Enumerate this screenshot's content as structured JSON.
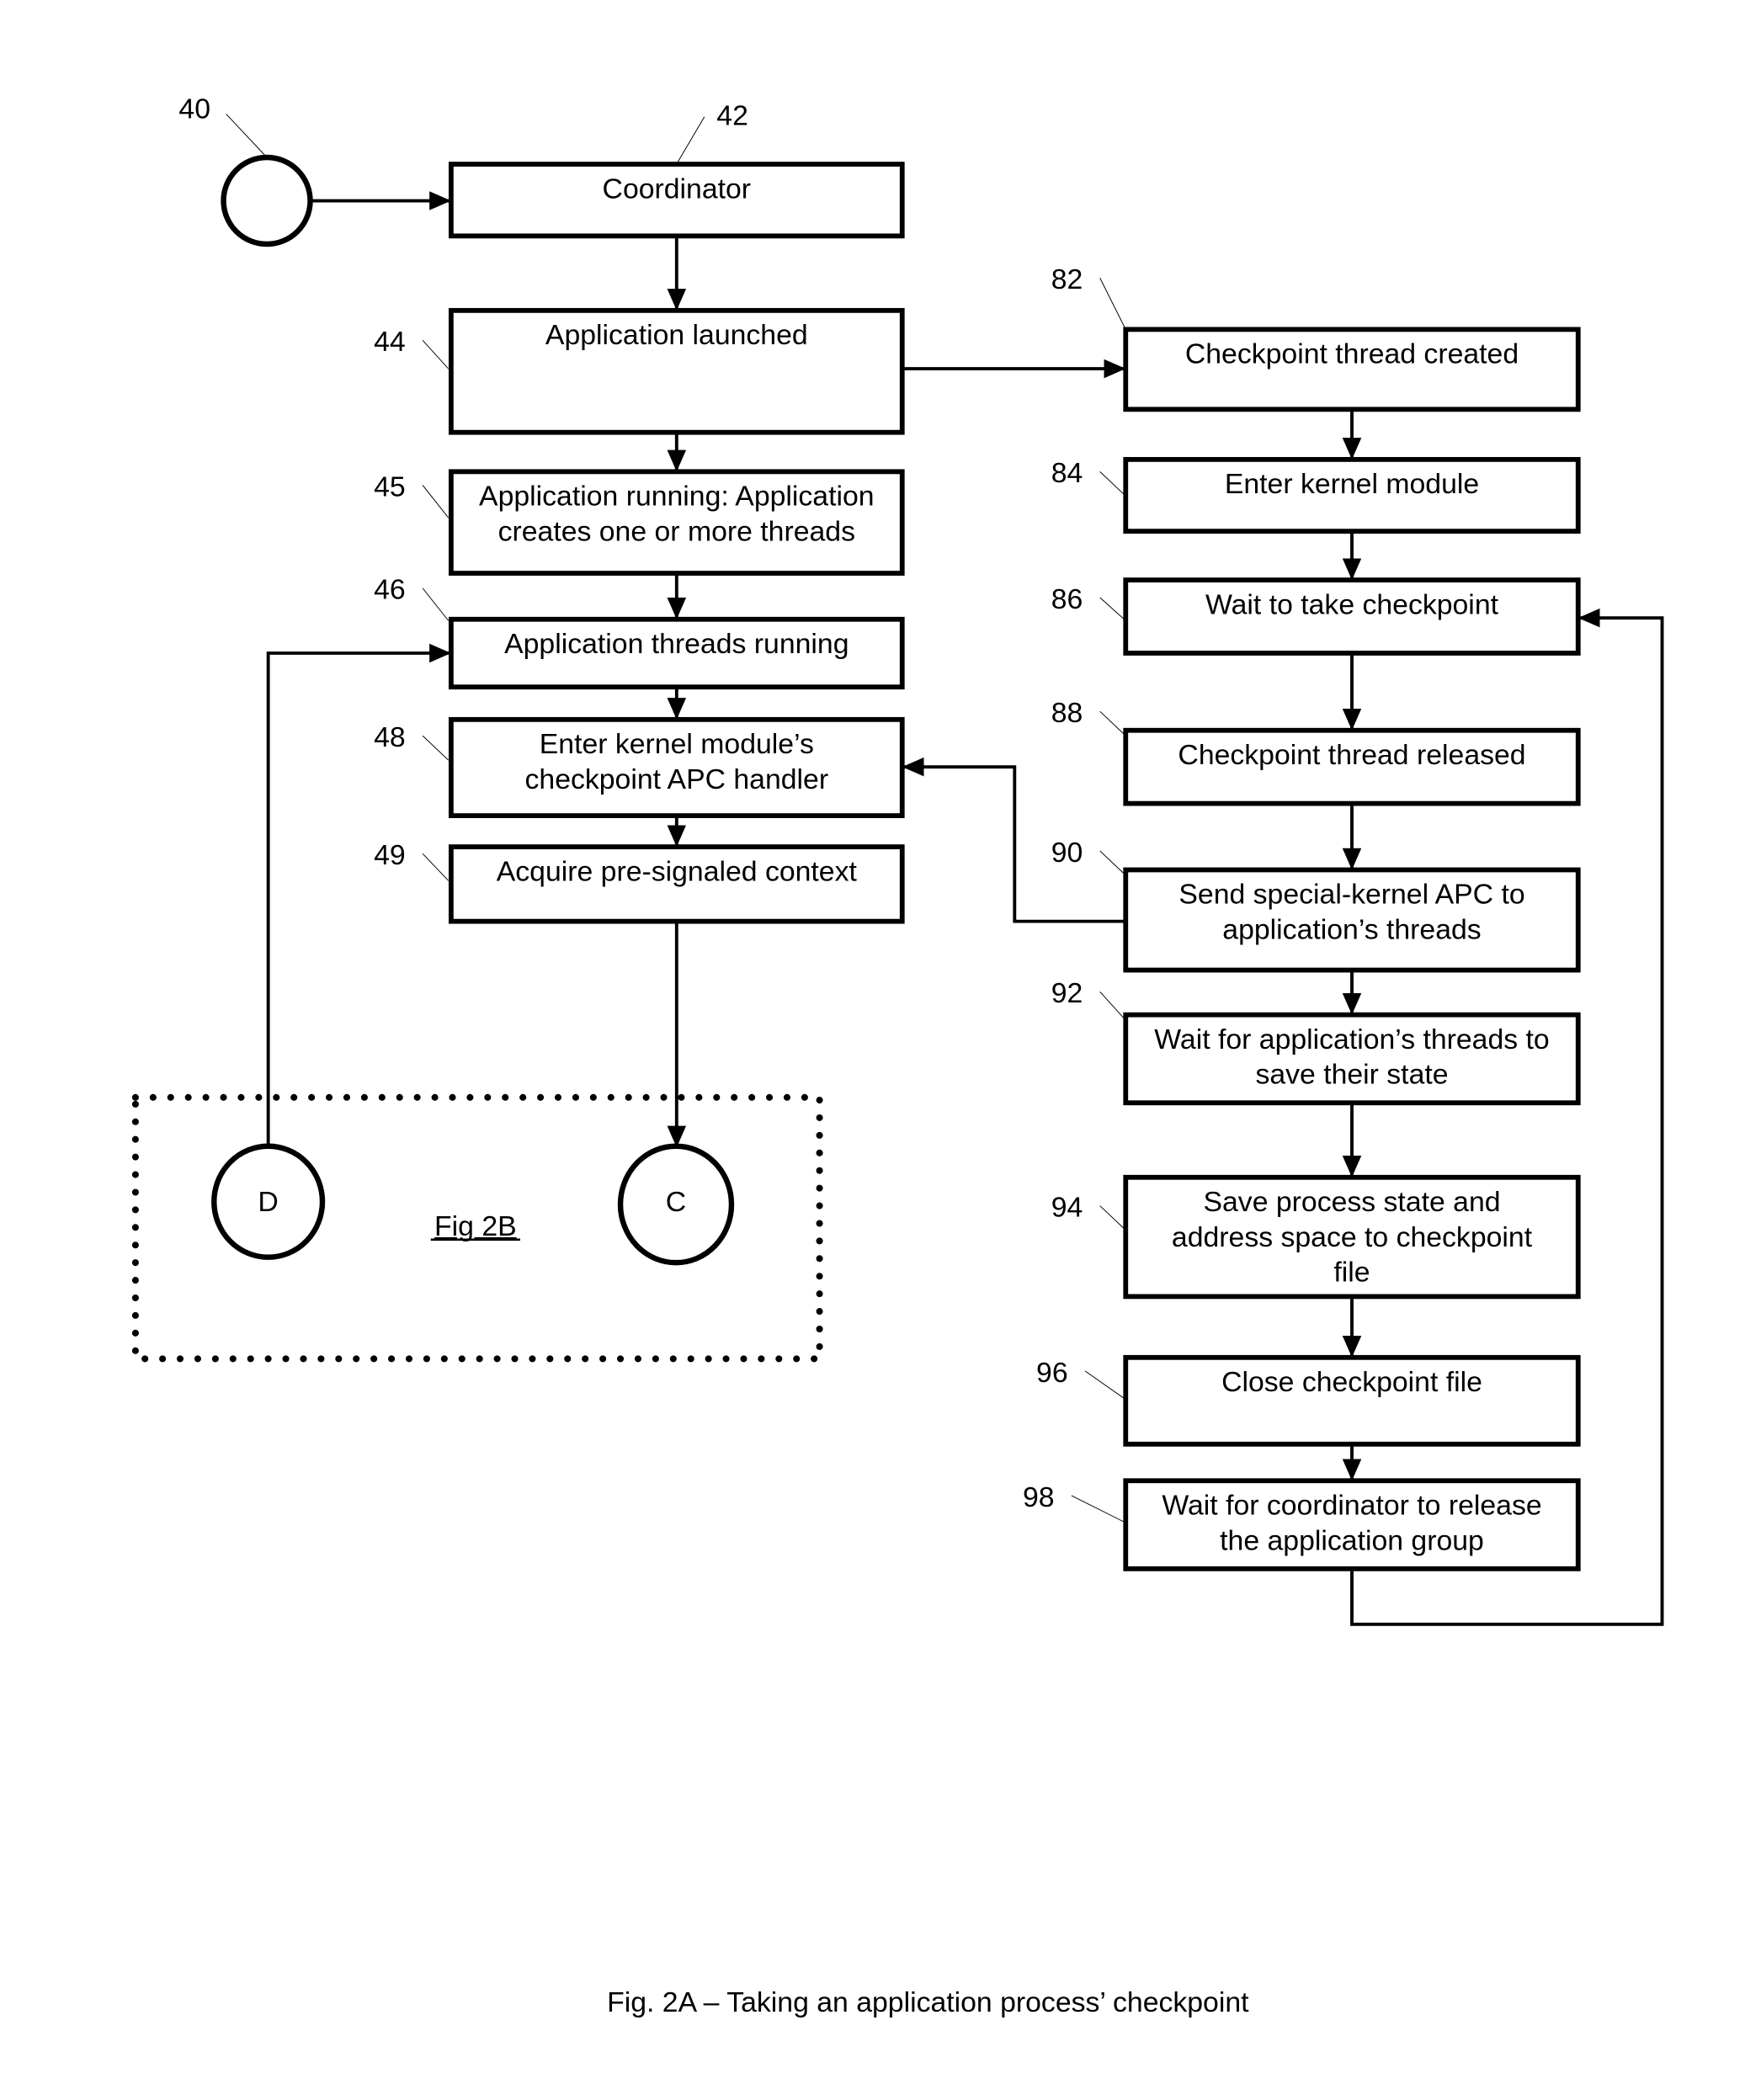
{
  "figure": {
    "caption": "Fig. 2A – Taking an application process’ checkpoint",
    "offpage_reference": "Fig 2B"
  },
  "start_node": {
    "ref": "40"
  },
  "connectors": [
    {
      "id": "D",
      "label": "D"
    },
    {
      "id": "C",
      "label": "C"
    }
  ],
  "left_column": [
    {
      "ref": "42",
      "lines": [
        "Coordinator"
      ]
    },
    {
      "ref": "44",
      "lines": [
        "Application launched"
      ]
    },
    {
      "ref": "45",
      "lines": [
        "Application running: Application",
        "creates one or more threads"
      ]
    },
    {
      "ref": "46",
      "lines": [
        "Application threads running"
      ]
    },
    {
      "ref": "48",
      "lines": [
        "Enter kernel module’s",
        "checkpoint APC handler"
      ]
    },
    {
      "ref": "49",
      "lines": [
        "Acquire pre-signaled context"
      ]
    }
  ],
  "right_column": [
    {
      "ref": "82",
      "lines": [
        "Checkpoint thread created"
      ]
    },
    {
      "ref": "84",
      "lines": [
        "Enter kernel module"
      ]
    },
    {
      "ref": "86",
      "lines": [
        "Wait to take checkpoint"
      ]
    },
    {
      "ref": "88",
      "lines": [
        "Checkpoint thread released"
      ]
    },
    {
      "ref": "90",
      "lines": [
        "Send special-kernel APC to",
        "application’s threads"
      ]
    },
    {
      "ref": "92",
      "lines": [
        "Wait for application’s threads to",
        "save their state"
      ]
    },
    {
      "ref": "94",
      "lines": [
        "Save process state and",
        "address space to checkpoint",
        "file"
      ]
    },
    {
      "ref": "96",
      "lines": [
        "Close checkpoint file"
      ]
    },
    {
      "ref": "98",
      "lines": [
        "Wait for coordinator to release",
        "the application group"
      ]
    }
  ]
}
